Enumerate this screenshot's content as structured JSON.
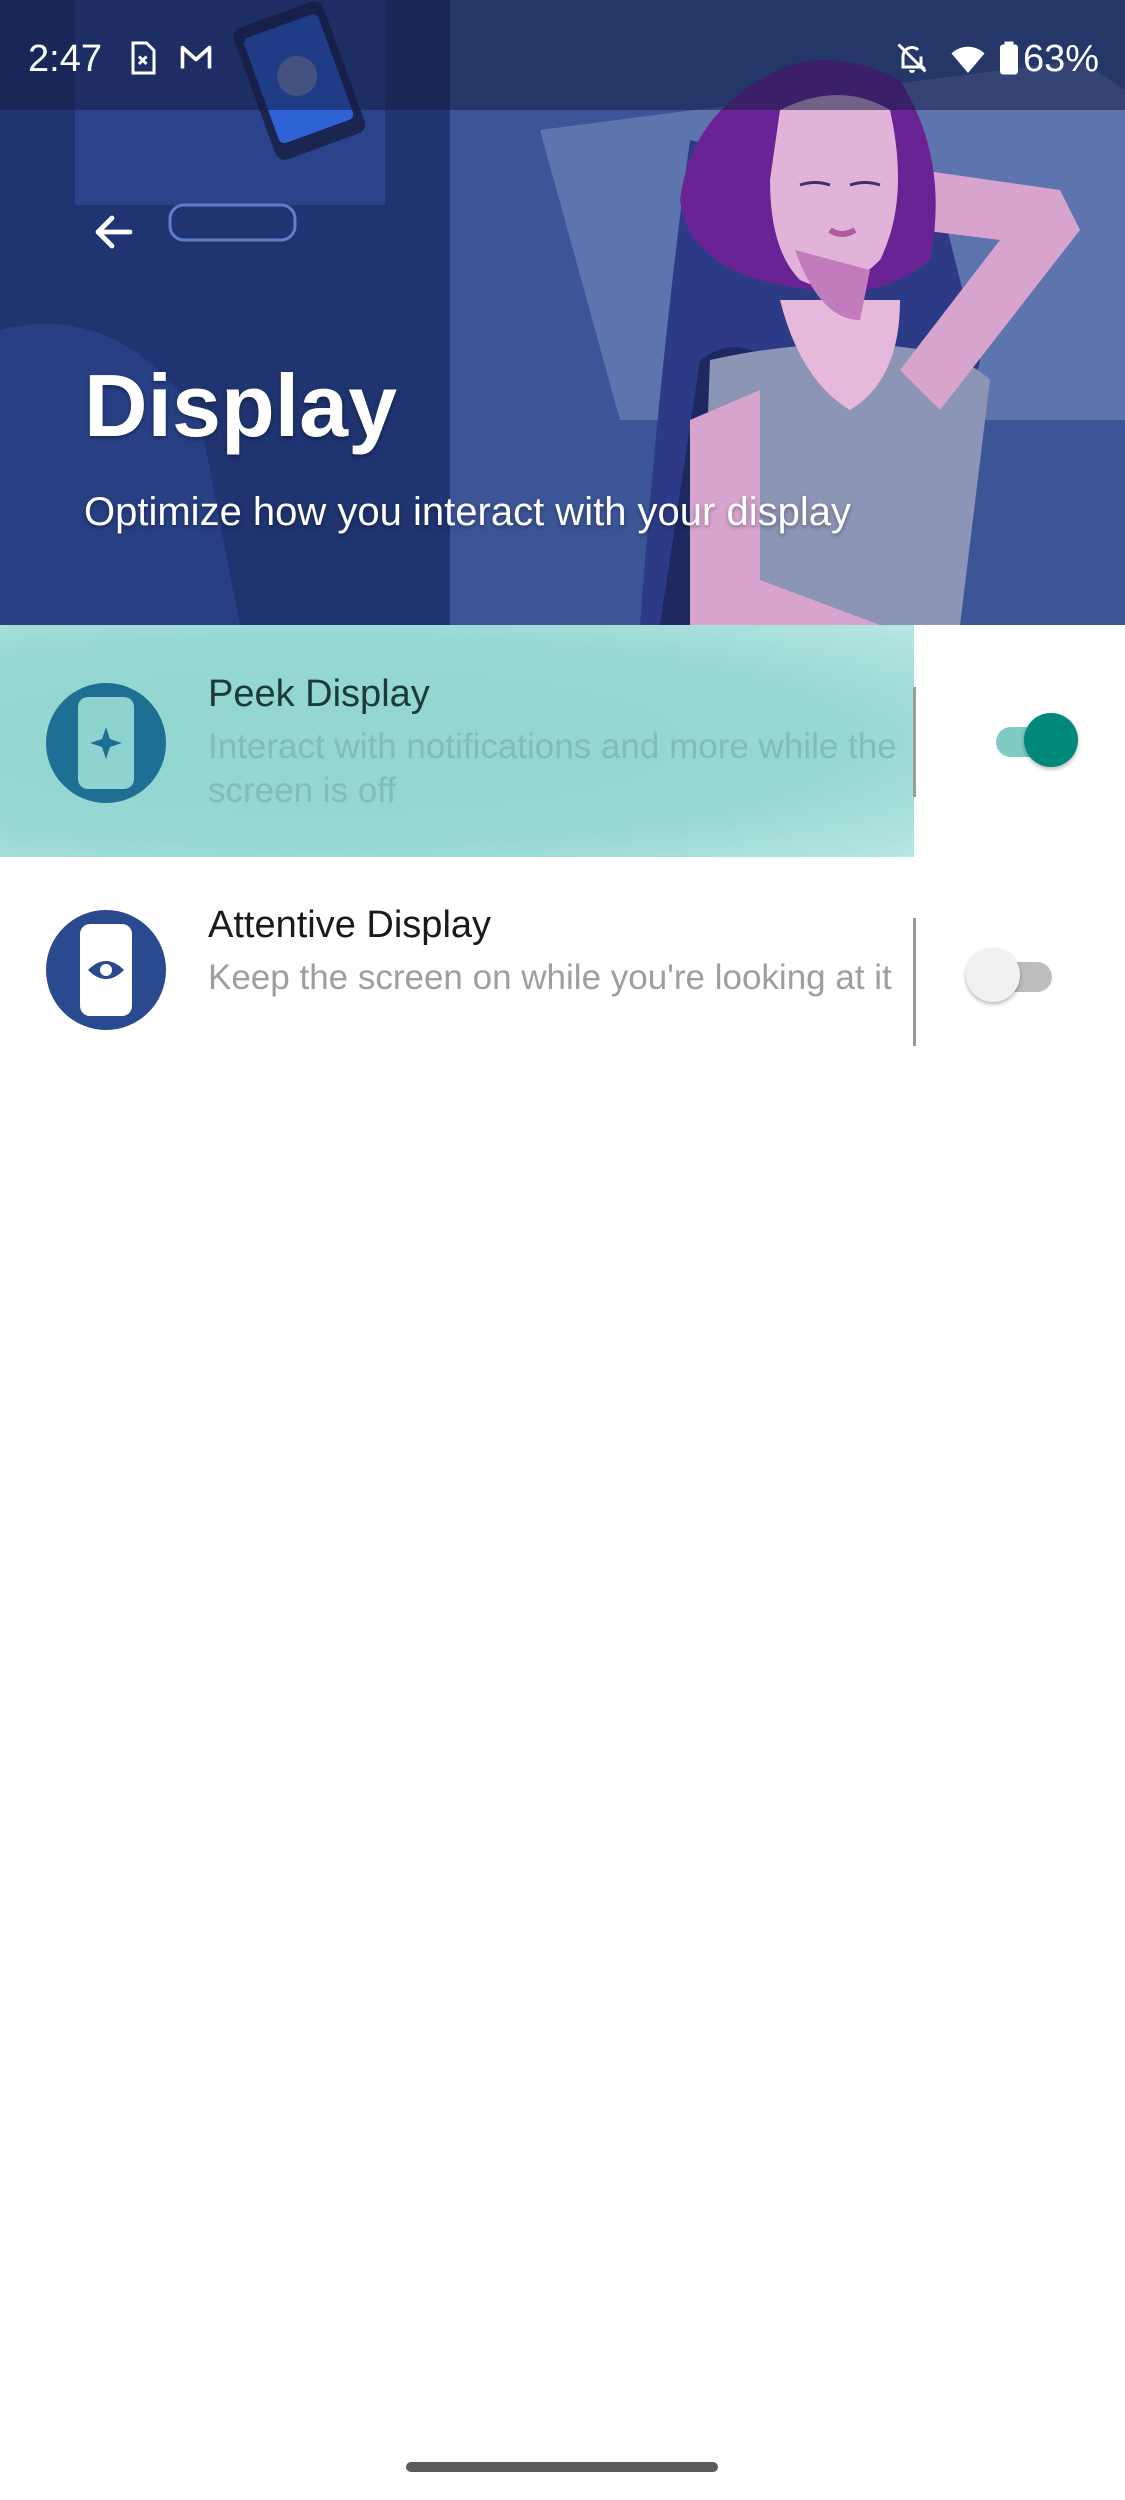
{
  "status_bar": {
    "time": "2:47",
    "battery": "63%",
    "icons": [
      "sim-error-icon",
      "gmail-icon",
      "notifications-off-icon",
      "wifi-icon",
      "battery-icon"
    ]
  },
  "header": {
    "title": "Display",
    "subtitle": "Optimize how you interact with your display",
    "back_icon": "back-arrow-icon"
  },
  "settings": [
    {
      "title": "Peek Display",
      "subtitle": "Interact with notifications and more while the screen is off",
      "enabled": true,
      "icon": "peek-display-icon",
      "icon_color": "#1f6f95"
    },
    {
      "title": "Attentive Display",
      "subtitle": "Keep the screen on while you're looking at it",
      "enabled": false,
      "icon": "attentive-display-icon",
      "icon_color": "#2a4a8f"
    }
  ],
  "colors": {
    "accent": "#00897b",
    "accent_track": "#80cbc4",
    "ripple": "#94d7d3",
    "header_bg": "#2b3f7a"
  }
}
